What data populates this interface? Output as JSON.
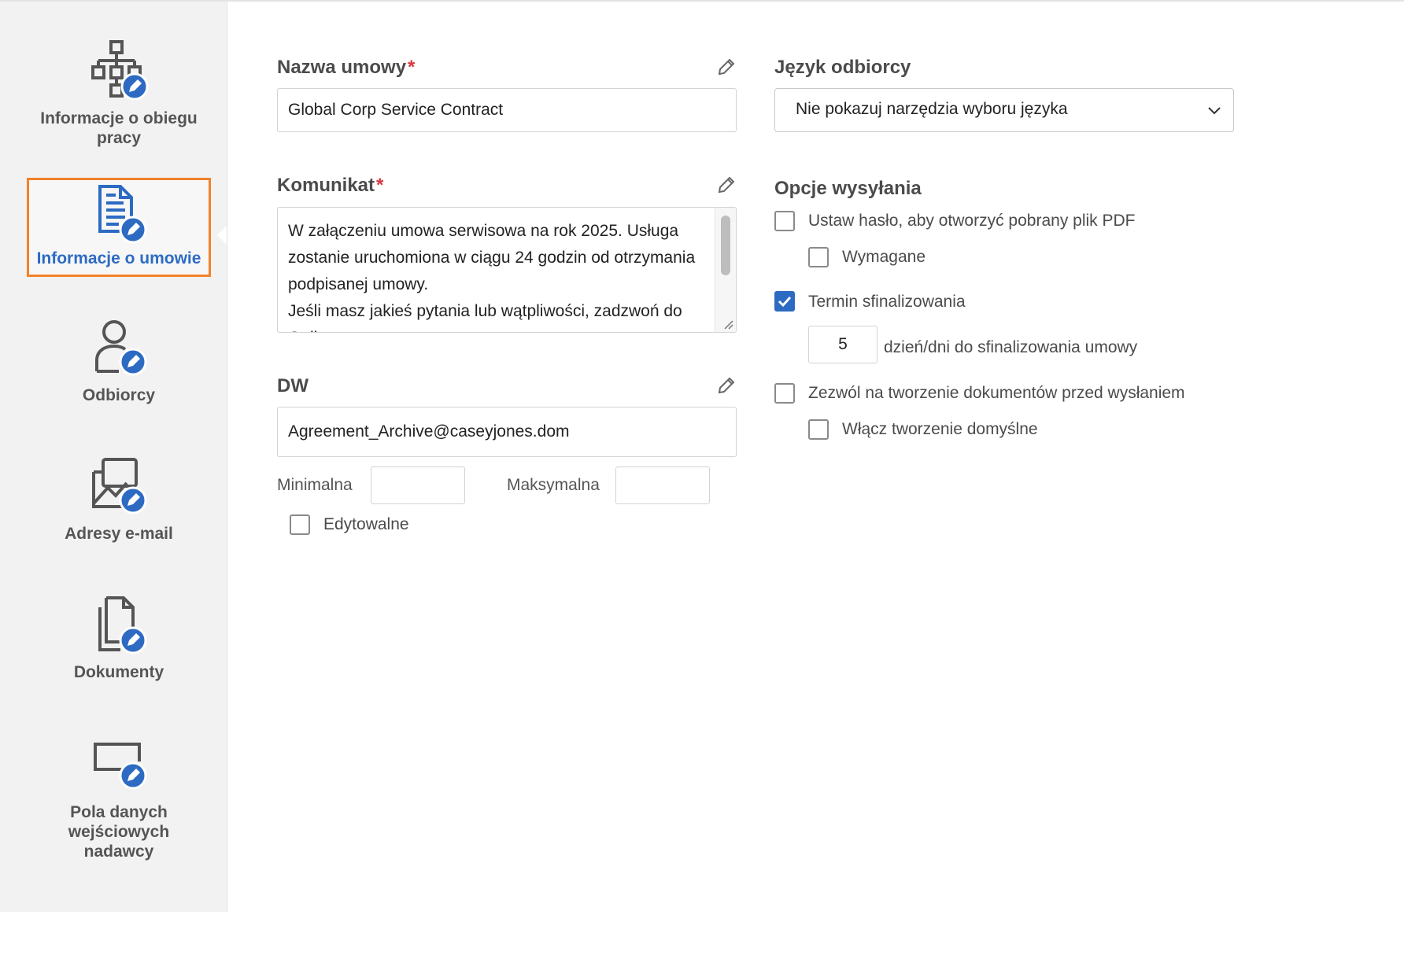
{
  "sidebar": {
    "items": [
      {
        "label": "Informacje o obiegu pracy",
        "icon": "workflow-icon",
        "active": false
      },
      {
        "label": "Informacje o umowie",
        "icon": "agreement-document-icon",
        "active": true
      },
      {
        "label": "Odbiorcy",
        "icon": "recipient-user-icon",
        "active": false
      },
      {
        "label": "Adresy e-mail",
        "icon": "email-image-icon",
        "active": false
      },
      {
        "label": "Dokumenty",
        "icon": "documents-icon",
        "active": false
      },
      {
        "label": "Pola danych wejściowych nadawcy",
        "icon": "input-field-icon",
        "active": false
      }
    ]
  },
  "form": {
    "agreement_name": {
      "label": "Nazwa umowy",
      "required_mark": "*",
      "value": "Global Corp Service Contract"
    },
    "message": {
      "label": "Komunikat",
      "required_mark": "*",
      "value": "W załączeniu umowa serwisowa na rok 2025. Usługa zostanie uruchomiona w ciągu 24 godzin od otrzymania podpisanej umowy.\nJeśli masz jakieś pytania lub wątpliwości, zadzwoń do Gail"
    },
    "cc": {
      "label": "DW",
      "value": "Agreement_Archive@caseyjones.dom",
      "min_label": "Minimalna",
      "min_value": "",
      "max_label": "Maksymalna",
      "max_value": "",
      "editable_label": "Edytowalne",
      "editable_checked": false
    },
    "recipient_language": {
      "label": "Język odbiorcy",
      "selected": "Nie pokazuj narzędzia wyboru języka"
    },
    "send_options": {
      "title": "Opcje wysyłania",
      "password": {
        "label": "Ustaw hasło, aby otworzyć pobrany plik PDF",
        "checked": false
      },
      "password_required": {
        "label": "Wymagane",
        "checked": false
      },
      "completion_deadline": {
        "label": "Termin sfinalizowania",
        "checked": true
      },
      "days_value": "5",
      "days_suffix": "dzień/dni do sfinalizowania umowy",
      "allow_authoring": {
        "label": "Zezwól na tworzenie dokumentów przed wysłaniem",
        "checked": false
      },
      "default_authoring": {
        "label": "Włącz tworzenie domyślne",
        "checked": false
      }
    }
  },
  "colors": {
    "accent": "#2d6bc2",
    "active_border": "#f2822a",
    "required": "#d7373f"
  }
}
